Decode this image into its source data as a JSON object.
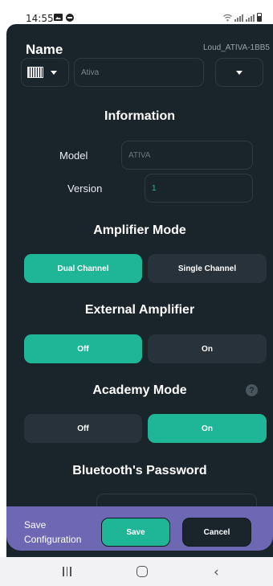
{
  "status_bar": {
    "time": "14:55",
    "icons": [
      "gallery-icon",
      "dnd-icon",
      "wifi-icon",
      "signal-icon",
      "signal-icon",
      "battery-icon"
    ]
  },
  "header": {
    "name_title": "Name",
    "device_id": "Loud_ATIVA-1BB5",
    "device_image_icon": "speaker-grille-icon",
    "name_value": "Ativa"
  },
  "information": {
    "title": "Information",
    "model_label": "Model",
    "model_value": "ATIVA",
    "version_label": "Version",
    "version_value": "1"
  },
  "amplifier_mode": {
    "title": "Amplifier Mode",
    "options": [
      {
        "label": "Dual Channel",
        "selected": true
      },
      {
        "label": "Single Channel",
        "selected": false
      }
    ]
  },
  "external_amplifier": {
    "title": "External Amplifier",
    "options": [
      {
        "label": "Off",
        "selected": true
      },
      {
        "label": "On",
        "selected": false
      }
    ]
  },
  "academy_mode": {
    "title": "Academy Mode",
    "help_icon": "question-circle-icon",
    "help_glyph": "?",
    "options": [
      {
        "label": "Off",
        "selected": false
      },
      {
        "label": "On",
        "selected": true
      }
    ]
  },
  "bluetooth_password": {
    "title": "Bluetooth's Password"
  },
  "footer": {
    "label": "Save Configuration",
    "save_label": "Save",
    "cancel_label": "Cancel"
  },
  "colors": {
    "background": "#1a242b",
    "accent": "#1fb597",
    "inactive_button": "#27323a",
    "footer": "#6e67b4",
    "version_text": "#1abc9c"
  },
  "nav_bar": {
    "icons": [
      "recent-apps-icon",
      "home-icon",
      "back-icon"
    ]
  }
}
